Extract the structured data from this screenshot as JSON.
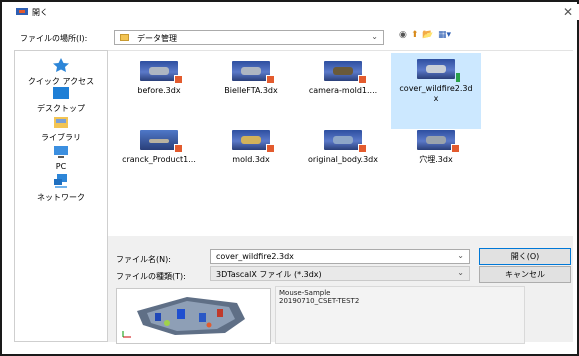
{
  "window": {
    "title": "開く",
    "close_glyph": "✕"
  },
  "location": {
    "label": "ファイルの場所(I):",
    "value": "データ管理",
    "arrow": "⌄"
  },
  "toolbar": {
    "back": "◉",
    "up": "⬆",
    "new_folder": "📂",
    "view": "▦▾"
  },
  "sidebar": {
    "items": [
      {
        "label": "クイック アクセス",
        "icon": "star-icon"
      },
      {
        "label": "デスクトップ",
        "icon": "desktop-icon"
      },
      {
        "label": "ライブラリ",
        "icon": "library-icon"
      },
      {
        "label": "PC",
        "icon": "pc-icon"
      },
      {
        "label": "ネットワーク",
        "icon": "network-icon"
      }
    ]
  },
  "files": [
    {
      "name": "before.3dx"
    },
    {
      "name": "BielleFTA.3dx"
    },
    {
      "name": "camera-mold1...."
    },
    {
      "name": "cover_wildfire2.3d",
      "name2": "x",
      "selected": true
    },
    {
      "name": "cranck_Product1..."
    },
    {
      "name": "mold.3dx"
    },
    {
      "name": "original_body.3dx"
    },
    {
      "name": "穴埋.3dx"
    }
  ],
  "filename": {
    "label": "ファイル名(N):",
    "value": "cover_wildfire2.3dx",
    "arrow": "⌄"
  },
  "filetype": {
    "label": "ファイルの種類(T):",
    "value": "3DTascalX ファイル (*.3dx)",
    "arrow": "⌄"
  },
  "buttons": {
    "open": "開く(O)",
    "cancel": "キャンセル"
  },
  "info": {
    "line1": "Mouse-Sample",
    "line2": "20190710_CSET-TEST2"
  },
  "colors": {
    "selection": "#cce8ff",
    "accent": "#0078d7"
  }
}
